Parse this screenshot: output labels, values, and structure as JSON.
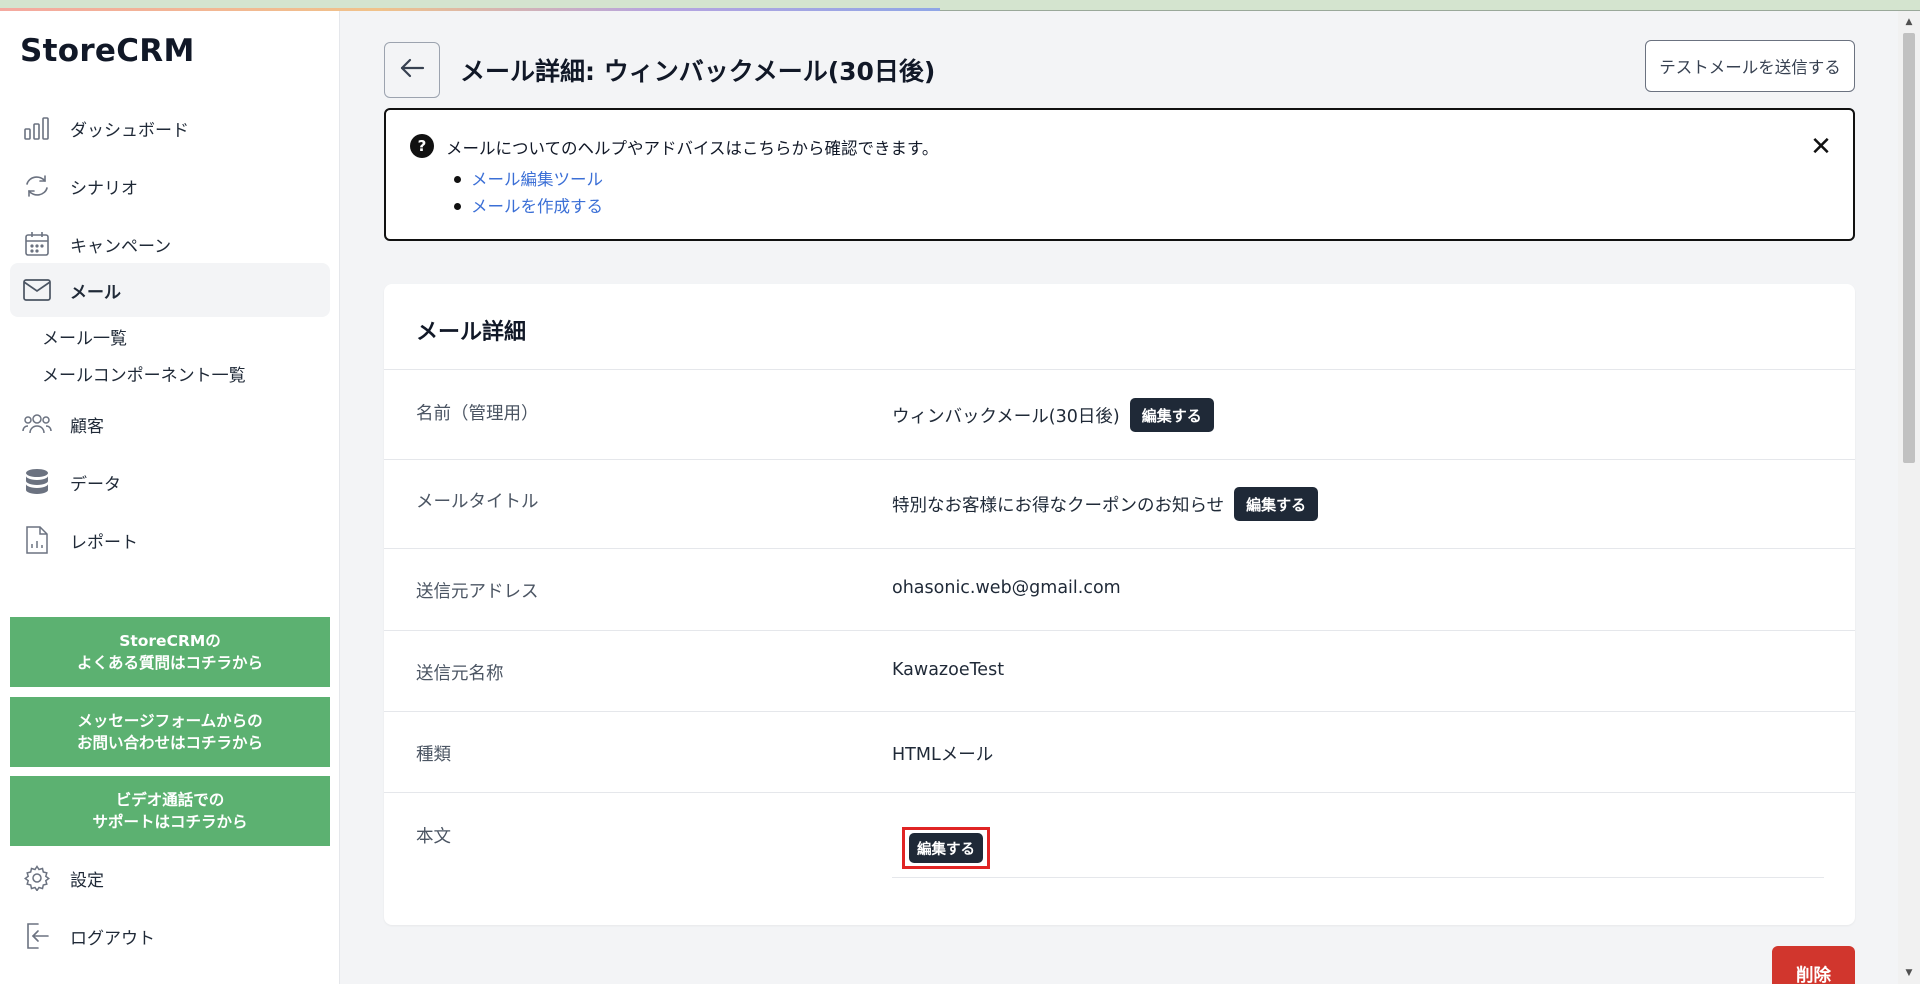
{
  "app": {
    "logo": "StoreCRM"
  },
  "sidebar": {
    "items": [
      {
        "label": "ダッシュボード",
        "icon": "bar-chart-icon"
      },
      {
        "label": "シナリオ",
        "icon": "refresh-icon"
      },
      {
        "label": "キャンペーン",
        "icon": "calendar-icon"
      },
      {
        "label": "メール",
        "icon": "mail-icon",
        "active": true
      },
      {
        "label": "顧客",
        "icon": "users-icon"
      },
      {
        "label": "データ",
        "icon": "database-icon"
      },
      {
        "label": "レポート",
        "icon": "report-icon"
      },
      {
        "label": "設定",
        "icon": "gear-icon"
      },
      {
        "label": "ログアウト",
        "icon": "logout-icon"
      }
    ],
    "sub_items": [
      "メール一覧",
      "メールコンポーネント一覧"
    ],
    "support_buttons": [
      {
        "line1": "StoreCRMの",
        "line2": "よくある質問はコチラから"
      },
      {
        "line1": "メッセージフォームからの",
        "line2": "お問い合わせはコチラから"
      },
      {
        "line1": "ビデオ通話での",
        "line2": "サポートはコチラから"
      }
    ],
    "support_color": "#5cb171"
  },
  "header": {
    "title": "メール詳細: ウィンバックメール(30日後)",
    "test_button": "テストメールを送信する"
  },
  "help": {
    "text": "メールについてのヘルプやアドバイスはこちらから確認できます。",
    "links": [
      "メール編集ツール",
      "メールを作成する"
    ]
  },
  "details": {
    "title": "メール詳細",
    "edit_label": "編集する",
    "rows": [
      {
        "label": "名前（管理用）",
        "value": "ウィンバックメール(30日後)"
      },
      {
        "label": "メールタイトル",
        "value": "特別なお客様にお得なクーポンのお知らせ"
      },
      {
        "label": "送信元アドレス",
        "value": "ohasonic.web@gmail.com"
      },
      {
        "label": "送信元名称",
        "value": "KawazoeTest"
      },
      {
        "label": "種類",
        "value": "HTMLメール"
      },
      {
        "label": "本文",
        "value": ""
      }
    ]
  },
  "actions": {
    "delete": "削除"
  },
  "colors": {
    "primary_dark": "#1f2937",
    "danger": "#d1362d",
    "highlight": "#e02424",
    "link": "#3b6fd6"
  }
}
